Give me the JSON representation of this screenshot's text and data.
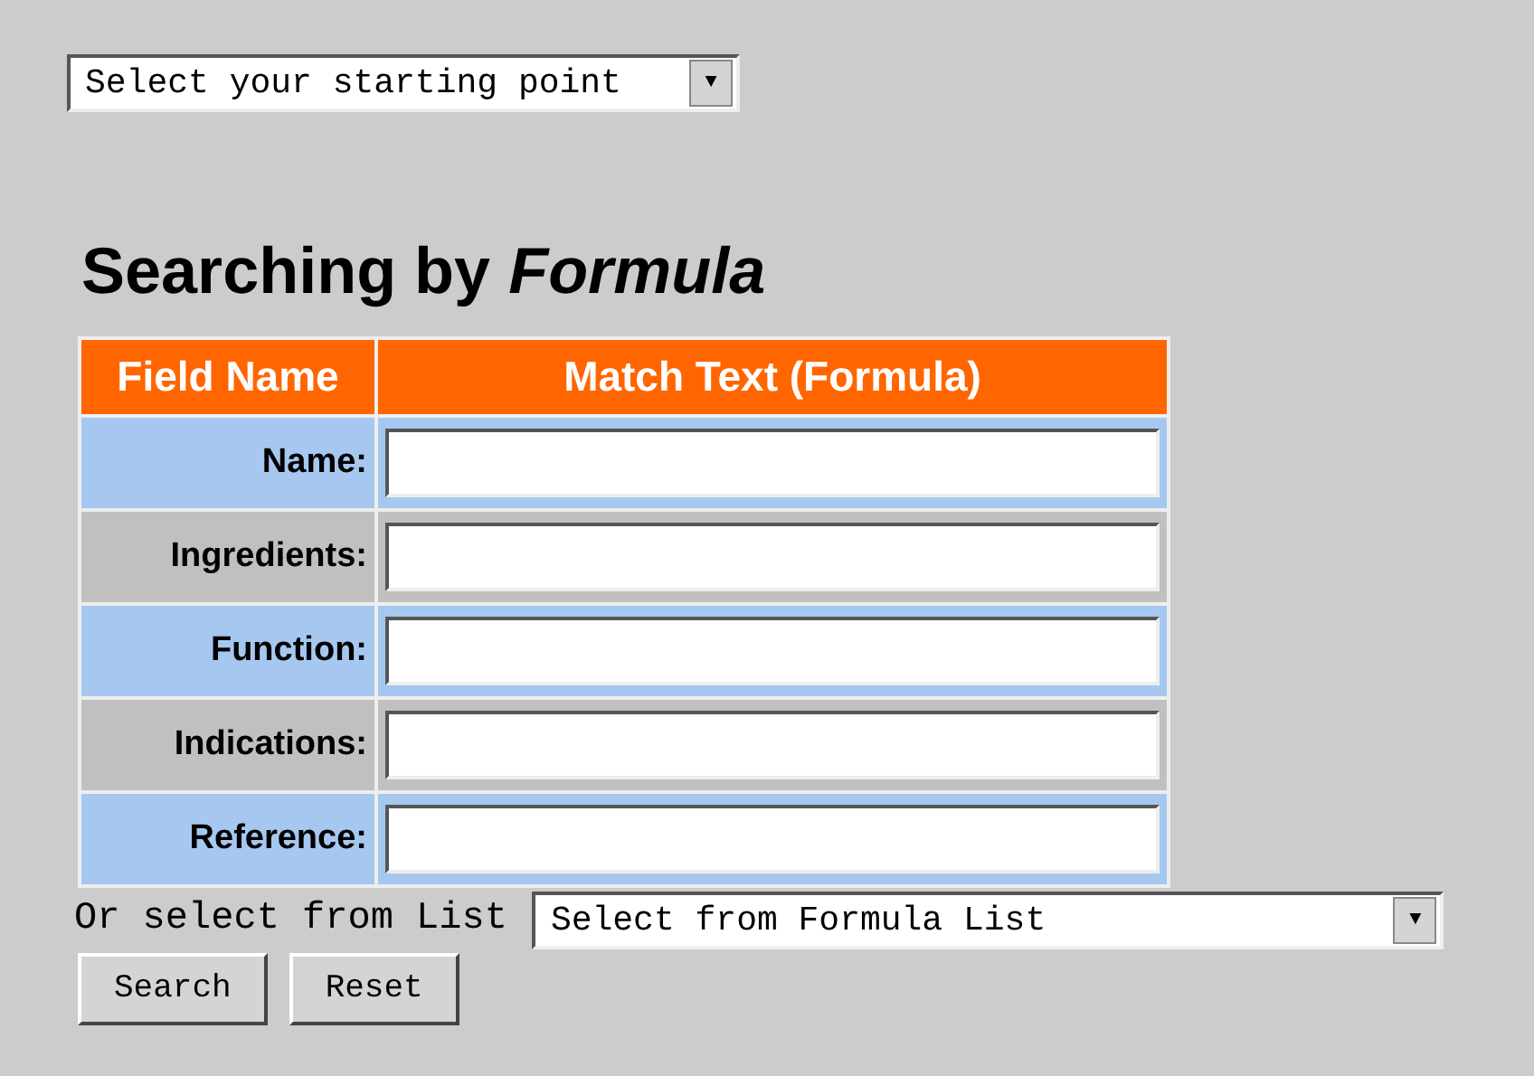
{
  "start_select": {
    "value": "Select your starting point",
    "arrow": "▼"
  },
  "heading": "Searching by *Formula*",
  "table": {
    "columns": [
      "Field Name",
      "Match Text (Formula)"
    ],
    "rows": [
      {
        "label": "Name:",
        "color": "#a6c8f0"
      },
      {
        "label": "Ingredients:",
        "color": "#c0c0c0"
      },
      {
        "label": "Function:",
        "color": "#a6c8f0"
      },
      {
        "label": "Indications:",
        "color": "#c0c0c0"
      },
      {
        "label": "Reference:",
        "color": "#a6c8f0"
      }
    ]
  },
  "list_label": "Or select from List",
  "list_select": {
    "value": "Select from Formula List",
    "arrow": "▼"
  },
  "buttons": [
    "Search",
    "Reset"
  ]
}
